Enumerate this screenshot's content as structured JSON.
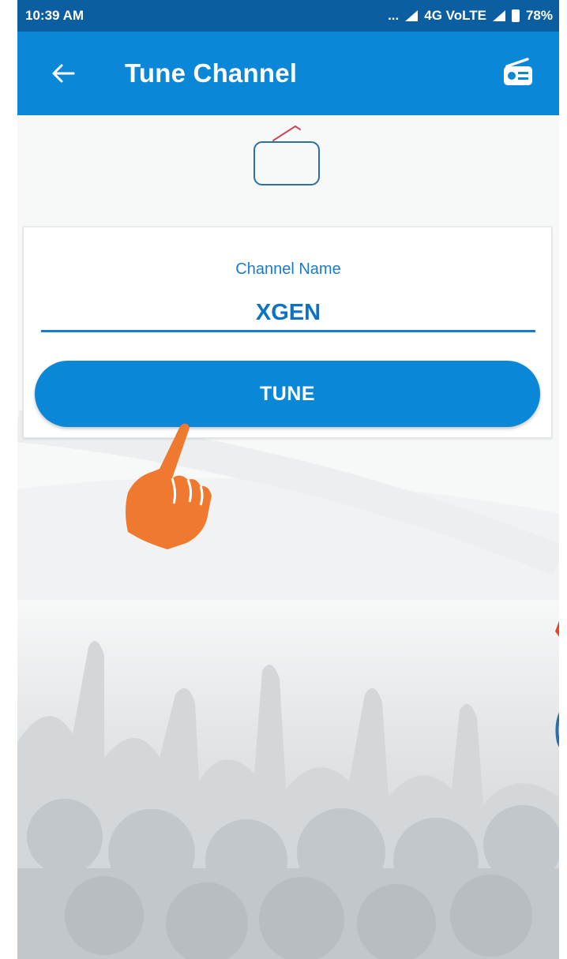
{
  "status_bar": {
    "time": "10:39 AM",
    "dots": "...",
    "network": "4G VoLTE",
    "battery": "78%"
  },
  "app_bar": {
    "title": "Tune Channel",
    "back_icon": "arrow-left-icon",
    "action_icon": "radio-icon"
  },
  "form": {
    "label": "Channel Name",
    "value": "XGEN"
  },
  "actions": {
    "tune_label": "TUNE"
  },
  "colors": {
    "app_bar": "#0a87d6",
    "status_bar": "#0b5e9f",
    "accent": "#1a7cc9",
    "hand": "#ef7a2f"
  }
}
